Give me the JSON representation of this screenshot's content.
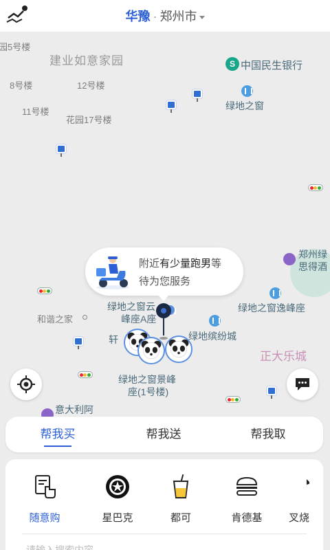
{
  "header": {
    "area": "华豫",
    "separator": "·",
    "city": "郑州市"
  },
  "map": {
    "labels": {
      "bldg5": "园5号楼",
      "jianye": "建业如意家园",
      "minsheng": "中国民生银行",
      "b8": "8号楼",
      "b12": "12号楼",
      "lvdi_window": "绿地之窗",
      "b11": "11号楼",
      "garden17": "花园17号楼",
      "zhengzhou_lv": "郑州绿",
      "side_hotel": "思得酒",
      "window_a1": "绿地之窗云",
      "window_a2": "峰座A座",
      "window_yi": "绿地之窗逸峰座",
      "hexie": "和谐之家",
      "xuan": "轩",
      "binfen": "绿地缤纷城",
      "zhengda": "正大乐城",
      "jingfeng1": "绿地之窗景峰",
      "jingfeng2": "座(1号楼)",
      "italy": "意大利阿"
    },
    "bubble": {
      "line1_prefix": "附近",
      "line1_highlight": "有少量跑男",
      "line1_suffix": "等",
      "line2": "待为您服务"
    }
  },
  "tabs": [
    {
      "label": "帮我买",
      "active": true
    },
    {
      "label": "帮我送",
      "active": false
    },
    {
      "label": "帮我取",
      "active": false
    }
  ],
  "categories": [
    {
      "label": "随意购",
      "icon": "hand-pointer-icon",
      "active": true
    },
    {
      "label": "星巴克",
      "icon": "starbucks-icon",
      "active": false
    },
    {
      "label": "都可",
      "icon": "drink-cup-icon",
      "active": false
    },
    {
      "label": "肯德基",
      "icon": "burger-icon",
      "active": false
    },
    {
      "label": "叉烧",
      "icon": "more-icon",
      "active": false
    }
  ],
  "search_hint": "请输入搜索内容",
  "colors": {
    "accent": "#2c5fd6",
    "map_bg": "#ececec",
    "bus": "#2f6fd4",
    "bank": "#1aa68a"
  }
}
